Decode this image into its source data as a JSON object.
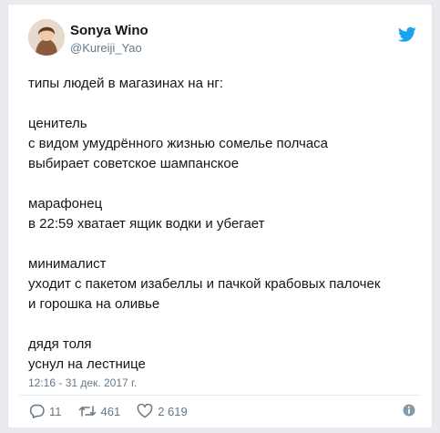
{
  "author": {
    "display_name": "Sonya Wino",
    "handle": "@Kureiji_Yao",
    "avatar_icon": "avatar-photo"
  },
  "brand": {
    "icon": "twitter-bird-icon",
    "color": "#1da1f2"
  },
  "tweet": {
    "text": "типы людей в магазинах на нг:\n\nценитель\nс видом умудрённого жизнью сомелье полчаса\nвыбирает советское шампанское\n\nмарафонец\nв 22:59 хватает ящик водки и убегает\n\nминималист\nуходит с пакетом изабеллы и пачкой крабовых палочек\nи горошка на оливье\n\nдядя толя\nуснул на лестнице",
    "timestamp": "12:16 - 31 дек. 2017 г."
  },
  "actions": {
    "replies": "11",
    "retweets": "461",
    "likes": "2 619",
    "info_icon": "info-icon"
  },
  "colors": {
    "text": "#14171a",
    "secondary": "#657786",
    "border": "#e1e8ed"
  }
}
